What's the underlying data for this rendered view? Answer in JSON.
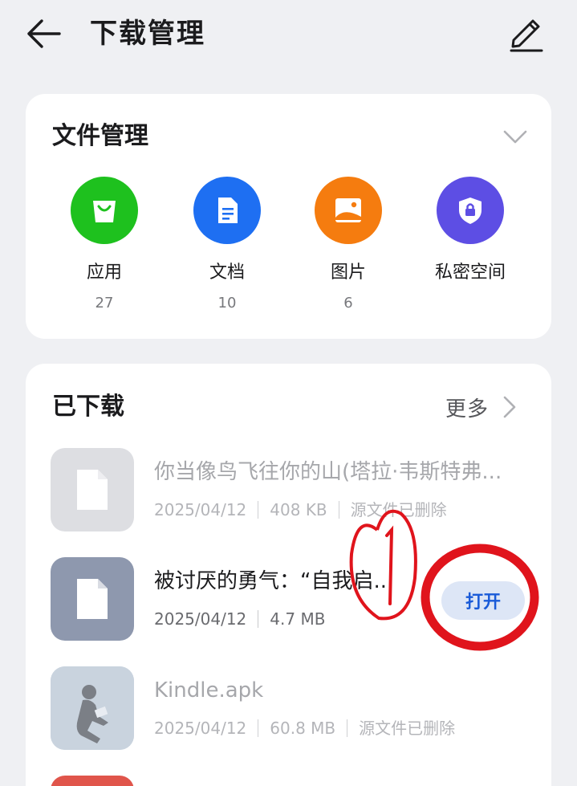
{
  "header": {
    "title": "下载管理",
    "back_icon": "arrow-left-icon",
    "edit_icon": "pencil-icon"
  },
  "file_management": {
    "title": "文件管理",
    "collapse_icon": "chevron-down-icon",
    "categories": [
      {
        "label": "应用",
        "count": "27",
        "icon": "shopping-bag-icon",
        "color": "#1ec11e"
      },
      {
        "label": "文档",
        "count": "10",
        "icon": "document-icon",
        "color": "#1e6ff2"
      },
      {
        "label": "图片",
        "count": "6",
        "icon": "image-icon",
        "color": "#f57c0f"
      },
      {
        "label": "私密空间",
        "count": "",
        "icon": "shield-lock-icon",
        "color": "#5d4ee4"
      }
    ]
  },
  "downloads": {
    "title": "已下载",
    "more_label": "更多",
    "items": [
      {
        "name": "你当像鸟飞往你的山(塔拉·韦斯特弗...",
        "date": "2025/04/12",
        "size": "408 KB",
        "status": "源文件已删除",
        "icon": "file-icon",
        "thumb_color": "#dddee2"
      },
      {
        "name": "被讨厌的勇气：“自我启..",
        "date": "2025/04/12",
        "size": "4.7 MB",
        "status": "",
        "icon": "file-icon",
        "thumb_color": "#8e98ae",
        "action_label": "打开"
      },
      {
        "name": "Kindle.apk",
        "date": "2025/04/12",
        "size": "60.8 MB",
        "status": "源文件已删除",
        "icon": "kindle-reader-icon",
        "thumb_color": "#c9d3de"
      }
    ]
  },
  "annotation": {
    "text": "①",
    "color": "#e0141c"
  }
}
